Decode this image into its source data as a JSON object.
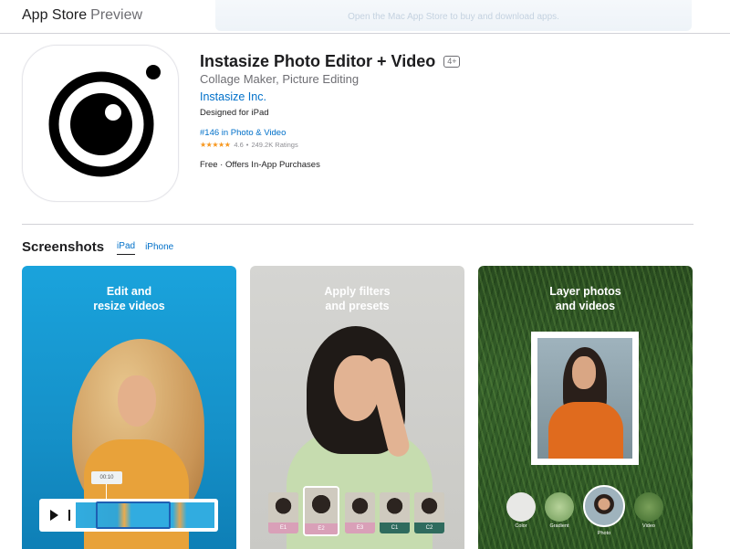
{
  "topbar": {
    "brand": "App Store",
    "brand_suffix": "Preview",
    "banner_text": "Open the Mac App Store to buy and download apps."
  },
  "app": {
    "title": "Instasize Photo Editor + Video",
    "age_rating": "4+",
    "subtitle": "Collage Maker, Picture Editing",
    "developer": "Instasize Inc.",
    "designed_for": "Designed for iPad",
    "rank": "#146 in Photo & Video",
    "stars": "★★★★★",
    "rating": "4.6",
    "rating_separator": "•",
    "ratings_count": "249.2K Ratings",
    "price": "Free · Offers In-App Purchases",
    "accent_color": "#0070c9"
  },
  "screenshots": {
    "title": "Screenshots",
    "tabs": [
      {
        "label": "iPad",
        "active": true
      },
      {
        "label": "iPhone",
        "active": false
      }
    ],
    "items": [
      {
        "caption": "Edit and\nresize videos",
        "timecode": "00:10"
      },
      {
        "caption": "Apply filters\nand presets",
        "filters": [
          "E1",
          "E2",
          "E3",
          "C1",
          "C2"
        ]
      },
      {
        "caption": "Layer photos\nand videos",
        "options": [
          "Color",
          "Gradient",
          "Photo",
          "Video"
        ]
      }
    ]
  }
}
